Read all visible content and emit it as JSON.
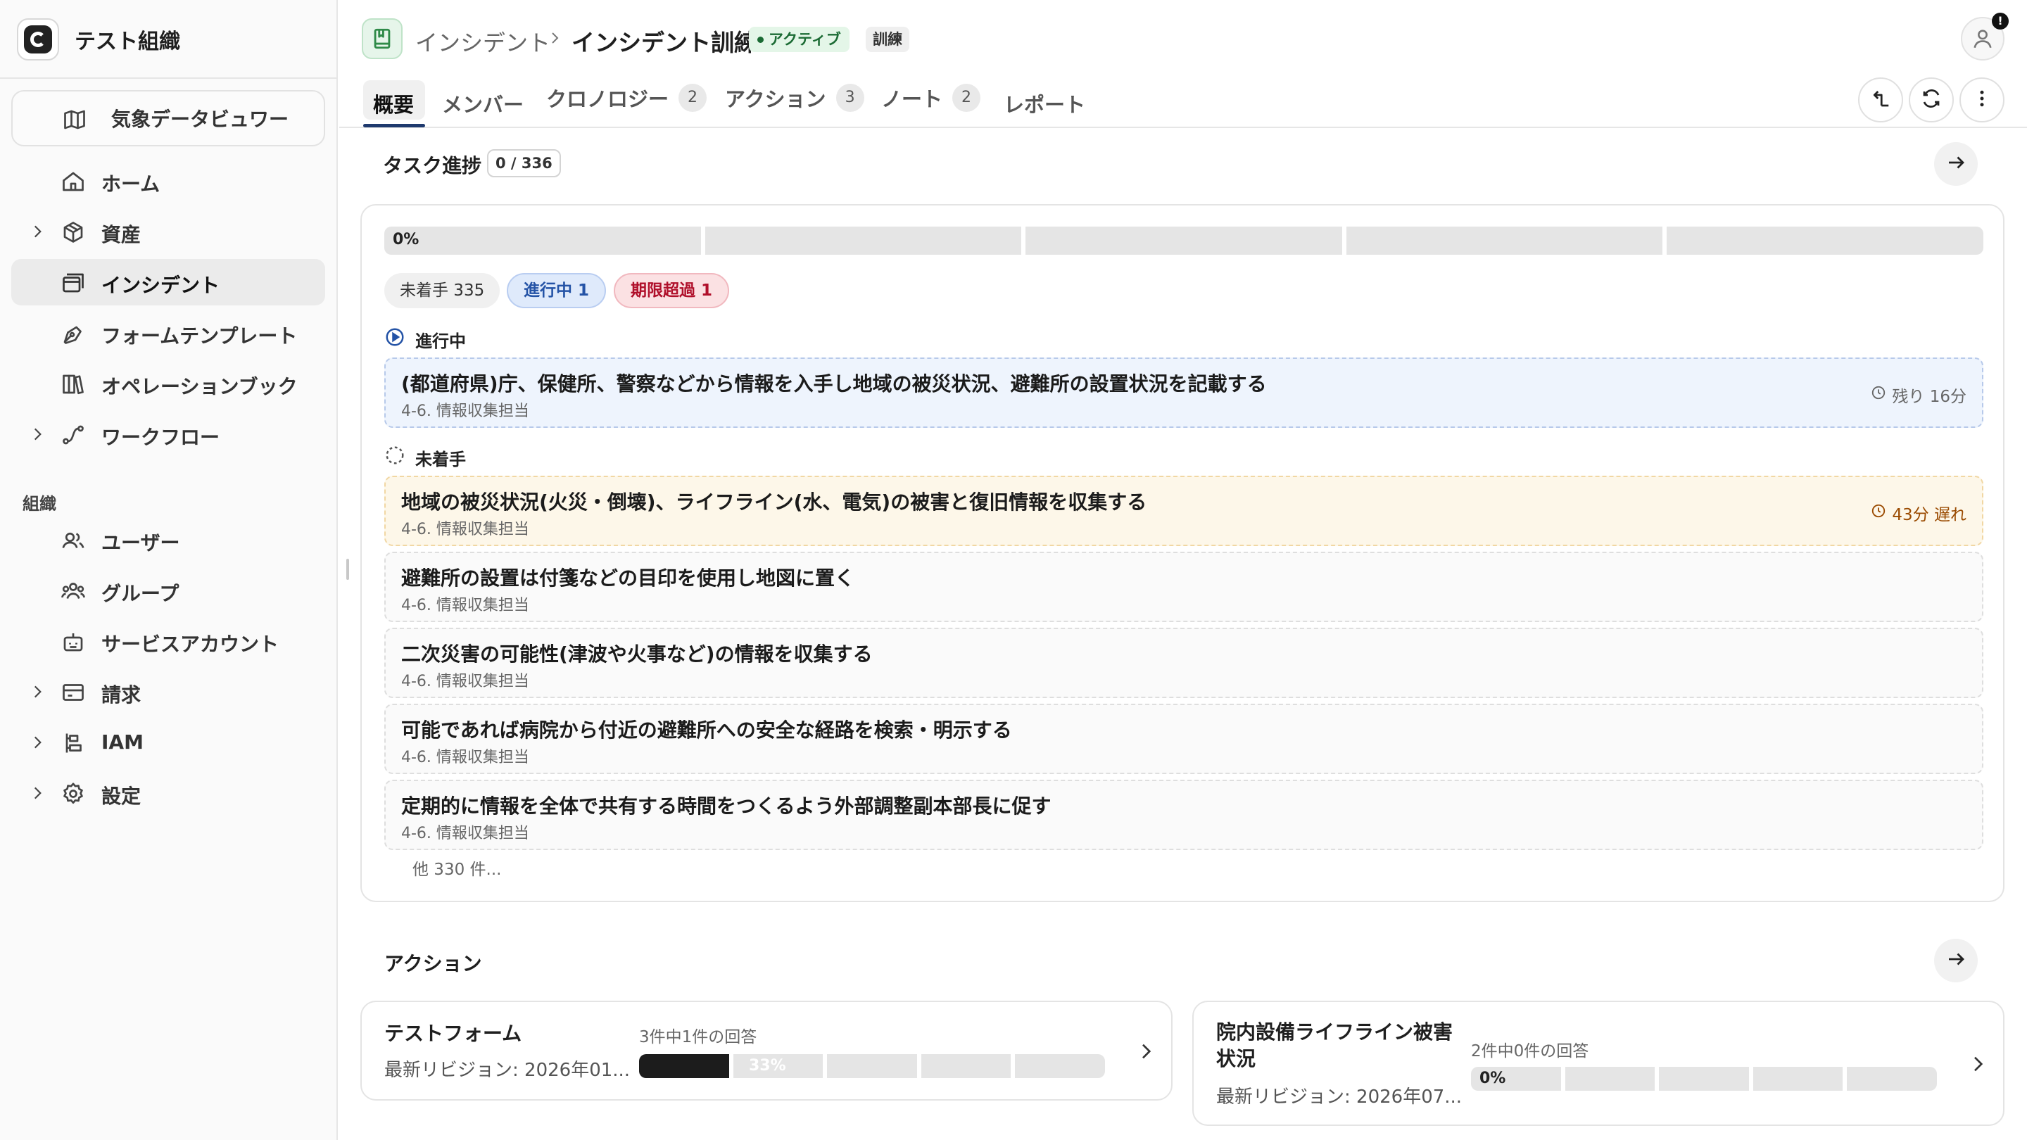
{
  "org": {
    "name": "テスト組織"
  },
  "sidebar": {
    "weather_label": "気象データビュワー",
    "items": [
      {
        "label": "ホーム",
        "icon": "home-icon",
        "expandable": false,
        "active": false
      },
      {
        "label": "資産",
        "icon": "box-icon",
        "expandable": true,
        "active": false
      },
      {
        "label": "インシデント",
        "icon": "incident-icon",
        "expandable": false,
        "active": true
      },
      {
        "label": "フォームテンプレート",
        "icon": "pen-icon",
        "expandable": false,
        "active": false
      },
      {
        "label": "オペレーションブック",
        "icon": "books-icon",
        "expandable": false,
        "active": false
      },
      {
        "label": "ワークフロー",
        "icon": "workflow-icon",
        "expandable": true,
        "active": false
      }
    ],
    "section_label": "組織",
    "org_items": [
      {
        "label": "ユーザー",
        "icon": "users-icon",
        "expandable": false
      },
      {
        "label": "グループ",
        "icon": "group-icon",
        "expandable": false
      },
      {
        "label": "サービスアカウント",
        "icon": "bot-icon",
        "expandable": false
      },
      {
        "label": "請求",
        "icon": "billing-icon",
        "expandable": true
      },
      {
        "label": "IAM",
        "icon": "iam-icon",
        "expandable": true
      },
      {
        "label": "設定",
        "icon": "gear-icon",
        "expandable": true
      }
    ]
  },
  "header": {
    "breadcrumb": "インシデント",
    "title": "インシデント訓練",
    "status_badge": "アクティブ",
    "type_badge": "訓練",
    "notification_mark": "!"
  },
  "tabs": [
    {
      "label": "概要",
      "count": ""
    },
    {
      "label": "メンバー",
      "count": ""
    },
    {
      "label": "クロノロジー",
      "count": "2"
    },
    {
      "label": "アクション",
      "count": "3"
    },
    {
      "label": "ノート",
      "count": "2"
    },
    {
      "label": "レポート",
      "count": ""
    }
  ],
  "progress": {
    "title": "タスク進捗",
    "count": "0 / 336",
    "percent_label": "0%",
    "fraction": 0,
    "chips": {
      "todo": "未着手 335",
      "in_progress": "進行中 1",
      "overdue": "期限超過 1"
    },
    "in_progress_group": "進行中",
    "todo_group": "未着手",
    "in_progress_tasks": [
      {
        "title": "(都道府県)庁、保健所、警察などから情報を入手し地域の被災状況、避難所の設置状況を記載する",
        "sub": "4-6. 情報収集担当",
        "due": "残り 16分"
      }
    ],
    "todo_tasks": [
      {
        "title": "地域の被災状況(火災・倒壊)、ライフライン(水、電気)の被害と復旧情報を収集する",
        "sub": "4-6. 情報収集担当",
        "due": "43分 遅れ"
      },
      {
        "title": "避難所の設置は付箋などの目印を使用し地図に置く",
        "sub": "4-6. 情報収集担当",
        "due": ""
      },
      {
        "title": "二次災害の可能性(津波や火事など)の情報を収集する",
        "sub": "4-6. 情報収集担当",
        "due": ""
      },
      {
        "title": "可能であれば病院から付近の避難所への安全な経路を検索・明示する",
        "sub": "4-6. 情報収集担当",
        "due": ""
      },
      {
        "title": "定期的に情報を全体で共有する時間をつくるよう外部調整副本部長に促す",
        "sub": "4-6. 情報収集担当",
        "due": ""
      }
    ],
    "more": "他 330 件..."
  },
  "actions": {
    "title": "アクション",
    "cards": [
      {
        "name": "テストフォーム",
        "revision": "最新リビジョン: 2026年01...",
        "responses": "3件中1件の回答",
        "percent_label": "33%",
        "fraction": 0.33
      },
      {
        "name_line1": "院内設備ライフライン被害",
        "name_line2": "状況",
        "revision": "最新リビジョン: 2026年07...",
        "responses": "2件中0件の回答",
        "percent_label": "0%",
        "fraction": 0
      }
    ]
  }
}
